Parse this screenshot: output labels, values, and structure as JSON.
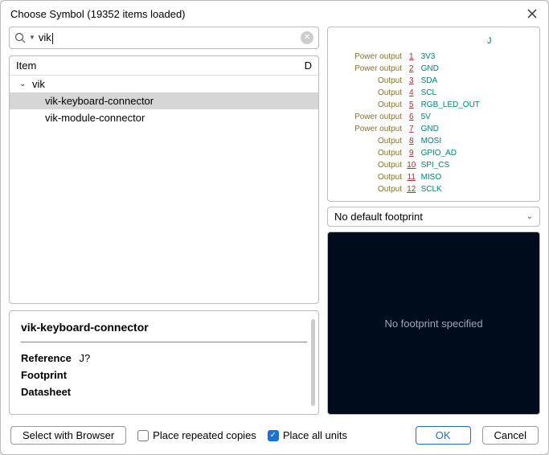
{
  "dialog": {
    "title": "Choose Symbol (19352 items loaded)"
  },
  "search": {
    "value": "vik",
    "placeholder": ""
  },
  "tree": {
    "header_item": "Item",
    "header_right": "D",
    "lib": "vik",
    "children": [
      "vik-keyboard-connector",
      "vik-module-connector"
    ],
    "selected_index": 0
  },
  "info": {
    "title": "vik-keyboard-connector",
    "reference_label": "Reference",
    "reference_value": "J?",
    "footprint_label": "Footprint",
    "footprint_value": "",
    "datasheet_label": "Datasheet",
    "datasheet_value": ""
  },
  "symbol": {
    "ref": "J",
    "pins": [
      {
        "type": "Power output",
        "num": "1",
        "name": "3V3"
      },
      {
        "type": "Power output",
        "num": "2",
        "name": "GND"
      },
      {
        "type": "Output",
        "num": "3",
        "name": "SDA"
      },
      {
        "type": "Output",
        "num": "4",
        "name": "SCL"
      },
      {
        "type": "Output",
        "num": "5",
        "name": "RGB_LED_OUT"
      },
      {
        "type": "Power output",
        "num": "6",
        "name": "5V"
      },
      {
        "type": "Power output",
        "num": "7",
        "name": "GND"
      },
      {
        "type": "Output",
        "num": "8",
        "name": "MOSI"
      },
      {
        "type": "Output",
        "num": "9",
        "name": "GPIO_AD"
      },
      {
        "type": "Output",
        "num": "10",
        "name": "SPI_CS"
      },
      {
        "type": "Output",
        "num": "11",
        "name": "MISO"
      },
      {
        "type": "Output",
        "num": "12",
        "name": "SCLK"
      }
    ]
  },
  "footprint_select": {
    "label": "No default footprint"
  },
  "footprint_preview": {
    "text": "No footprint specified"
  },
  "footer": {
    "browser_btn": "Select with Browser",
    "repeat_label": "Place repeated copies",
    "all_units_label": "Place all units",
    "ok": "OK",
    "cancel": "Cancel"
  }
}
